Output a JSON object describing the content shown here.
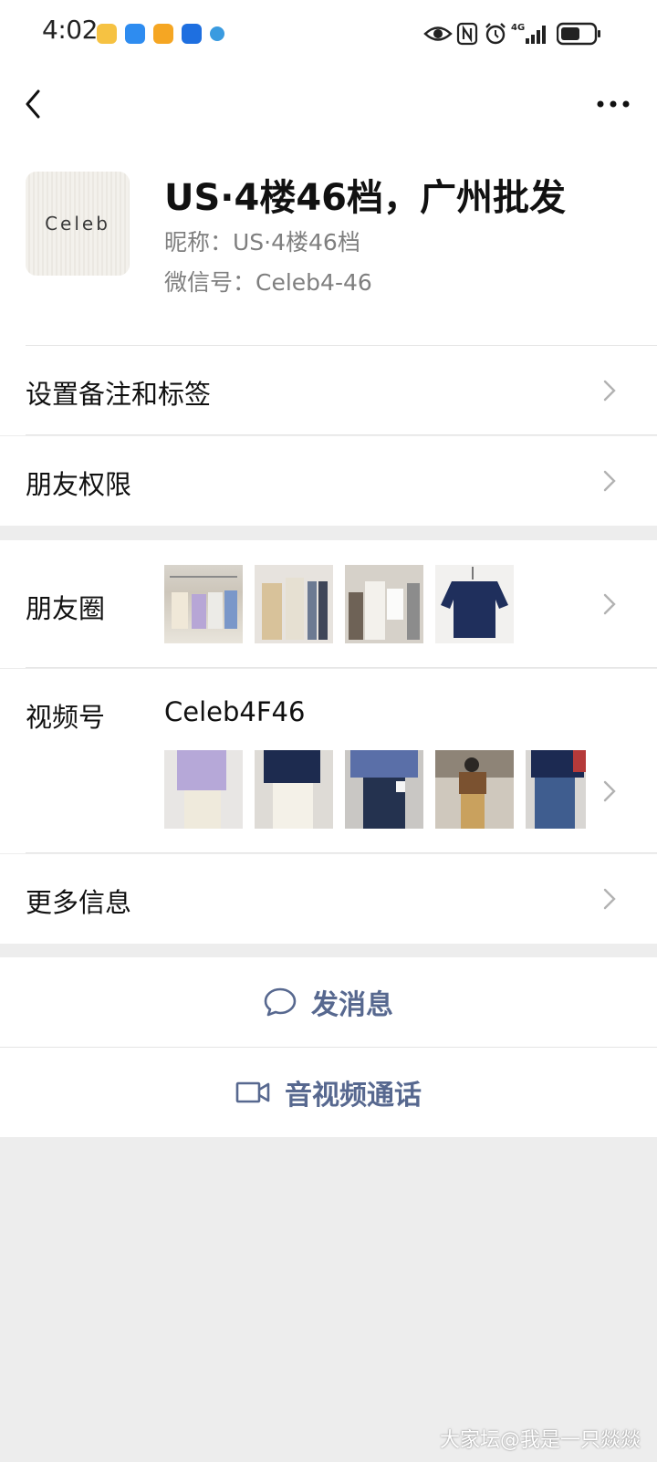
{
  "status_bar": {
    "time": "4:02",
    "app_icons": [
      "weibo-icon",
      "weather-icon",
      "video-icon",
      "tips-icon",
      "telegram-icon"
    ],
    "right_icons": [
      "eye-icon",
      "nfc-icon",
      "alarm-icon",
      "signal-icon",
      "battery-icon"
    ],
    "network": "4G"
  },
  "profile": {
    "avatar_text": "Celeb",
    "display_name": "US·4楼46档，广州批发",
    "nickname": "昵称：US·4楼46档",
    "wechat_id": "微信号：Celeb4-46"
  },
  "menu": {
    "remarks_label": "设置备注和标签",
    "permissions_label": "朋友权限",
    "moments_label": "朋友圈",
    "channels_label": "视频号",
    "channels_name": "Celeb4F46",
    "more_info_label": "更多信息"
  },
  "actions": {
    "message_label": "发消息",
    "call_label": "音视频通话"
  },
  "watermark": "大家坛@我是一只燚燚",
  "colors": {
    "link": "#57688f",
    "background": "#ededed",
    "secondary_text": "#7f7f7f"
  }
}
